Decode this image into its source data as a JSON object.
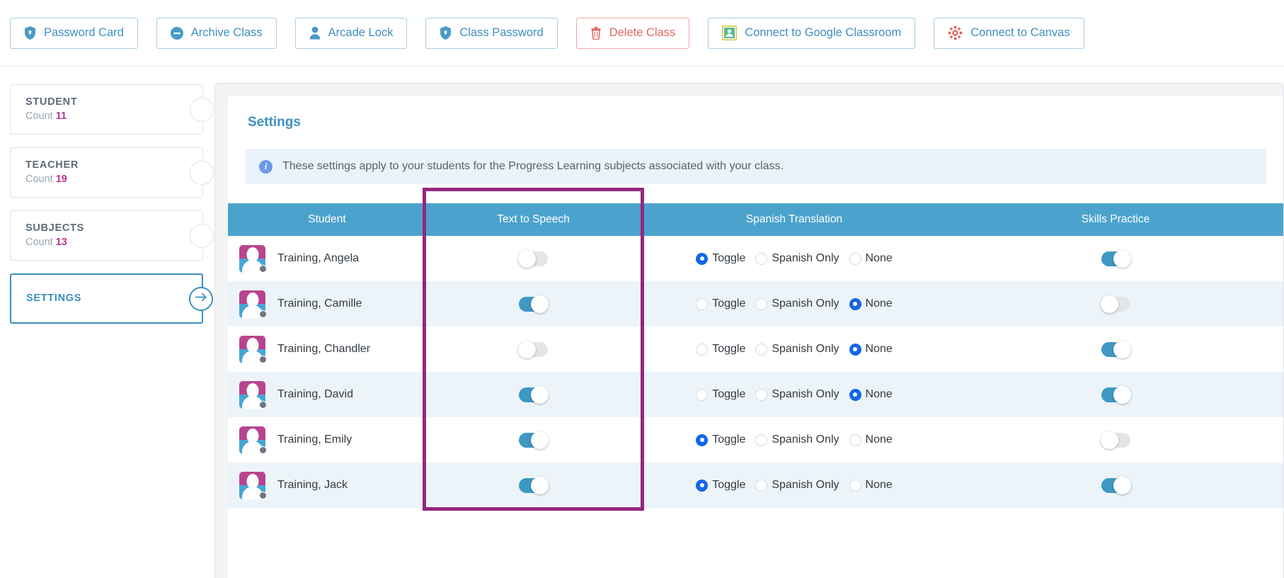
{
  "toolbar": {
    "buttons": [
      {
        "label": "Password Card",
        "icon": "shield-lock-icon",
        "style": "primary"
      },
      {
        "label": "Archive Class",
        "icon": "minus-circle-icon",
        "style": "primary"
      },
      {
        "label": "Arcade Lock",
        "icon": "person-icon",
        "style": "primary"
      },
      {
        "label": "Class Password",
        "icon": "shield-lock-icon",
        "style": "primary"
      },
      {
        "label": "Delete Class",
        "icon": "trash-icon",
        "style": "danger"
      },
      {
        "label": "Connect to Google Classroom",
        "icon": "google-classroom-icon",
        "style": "primary"
      },
      {
        "label": "Connect to Canvas",
        "icon": "canvas-icon",
        "style": "primary"
      }
    ]
  },
  "sidebar": {
    "cards": [
      {
        "title": "STUDENT",
        "count_label": "Count",
        "count": "11",
        "active": false
      },
      {
        "title": "TEACHER",
        "count_label": "Count",
        "count": "19",
        "active": false
      },
      {
        "title": "SUBJECTS",
        "count_label": "Count",
        "count": "13",
        "active": false
      },
      {
        "title": "SETTINGS",
        "count_label": "",
        "count": "",
        "active": true
      }
    ]
  },
  "main": {
    "panel_title": "Settings",
    "info_message": "These settings apply to your students for the Progress Learning subjects associated with your class.",
    "info_icon": "info-icon",
    "table": {
      "headers": [
        "Student",
        "Text to Speech",
        "Spanish Translation",
        "Skills Practice"
      ],
      "spanish_options": [
        "Toggle",
        "Spanish Only",
        "None"
      ],
      "rows": [
        {
          "name": "Training, Angela",
          "text_to_speech": false,
          "spanish": "Toggle",
          "skills_practice": true
        },
        {
          "name": "Training, Camille",
          "text_to_speech": true,
          "spanish": "None",
          "skills_practice": false
        },
        {
          "name": "Training, Chandler",
          "text_to_speech": false,
          "spanish": "None",
          "skills_practice": true
        },
        {
          "name": "Training, David",
          "text_to_speech": true,
          "spanish": "None",
          "skills_practice": true
        },
        {
          "name": "Training, Emily",
          "text_to_speech": true,
          "spanish": "Toggle",
          "skills_practice": false
        },
        {
          "name": "Training, Jack",
          "text_to_speech": true,
          "spanish": "Toggle",
          "skills_practice": true
        }
      ]
    },
    "highlight": {
      "column": "Text to Speech",
      "color": "#95277e"
    }
  },
  "colors": {
    "accent_blue": "#3d8fbe",
    "header_blue": "#4ba3cd",
    "toggle_on": "#3f97c4",
    "radio_selected": "#1366e8",
    "count_magenta": "#b8348f",
    "danger_red": "#e4685e",
    "highlight_purple": "#95277e"
  }
}
